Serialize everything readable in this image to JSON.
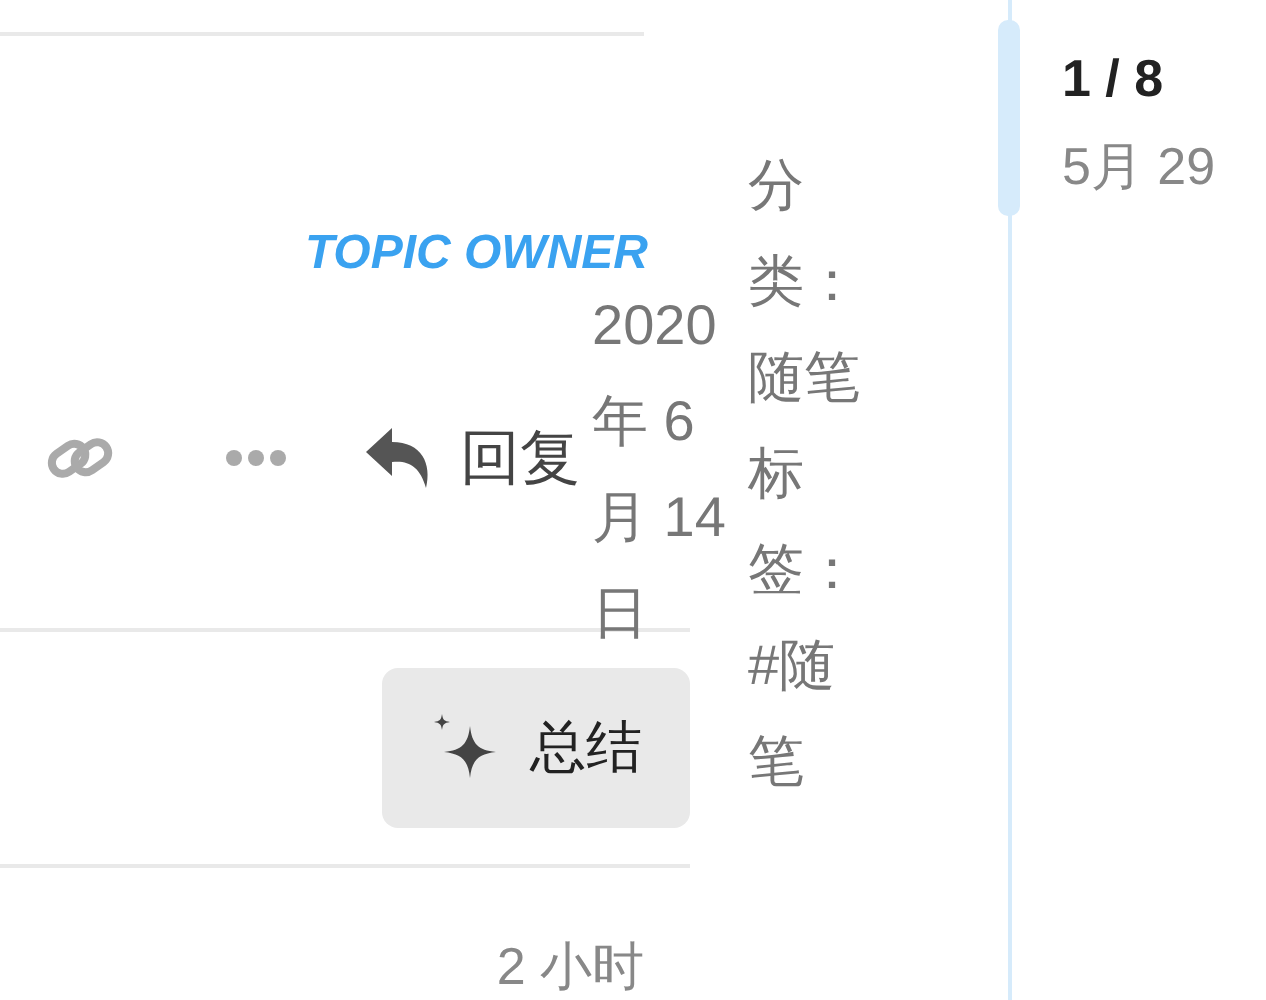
{
  "post": {
    "author_badge": "TOPIC OWNER",
    "actions": [
      {
        "kind": "link"
      },
      {
        "kind": "more"
      },
      {
        "kind": "reply",
        "label": "回复"
      }
    ],
    "date": "2020 年 6 月 14 日",
    "meta": "分类：随笔标签：#随笔"
  },
  "summary_button": {
    "label": "总结"
  },
  "next_post": {
    "time": "2 小时"
  },
  "timeline": {
    "position": "1 / 8",
    "date": "5月 29"
  }
}
